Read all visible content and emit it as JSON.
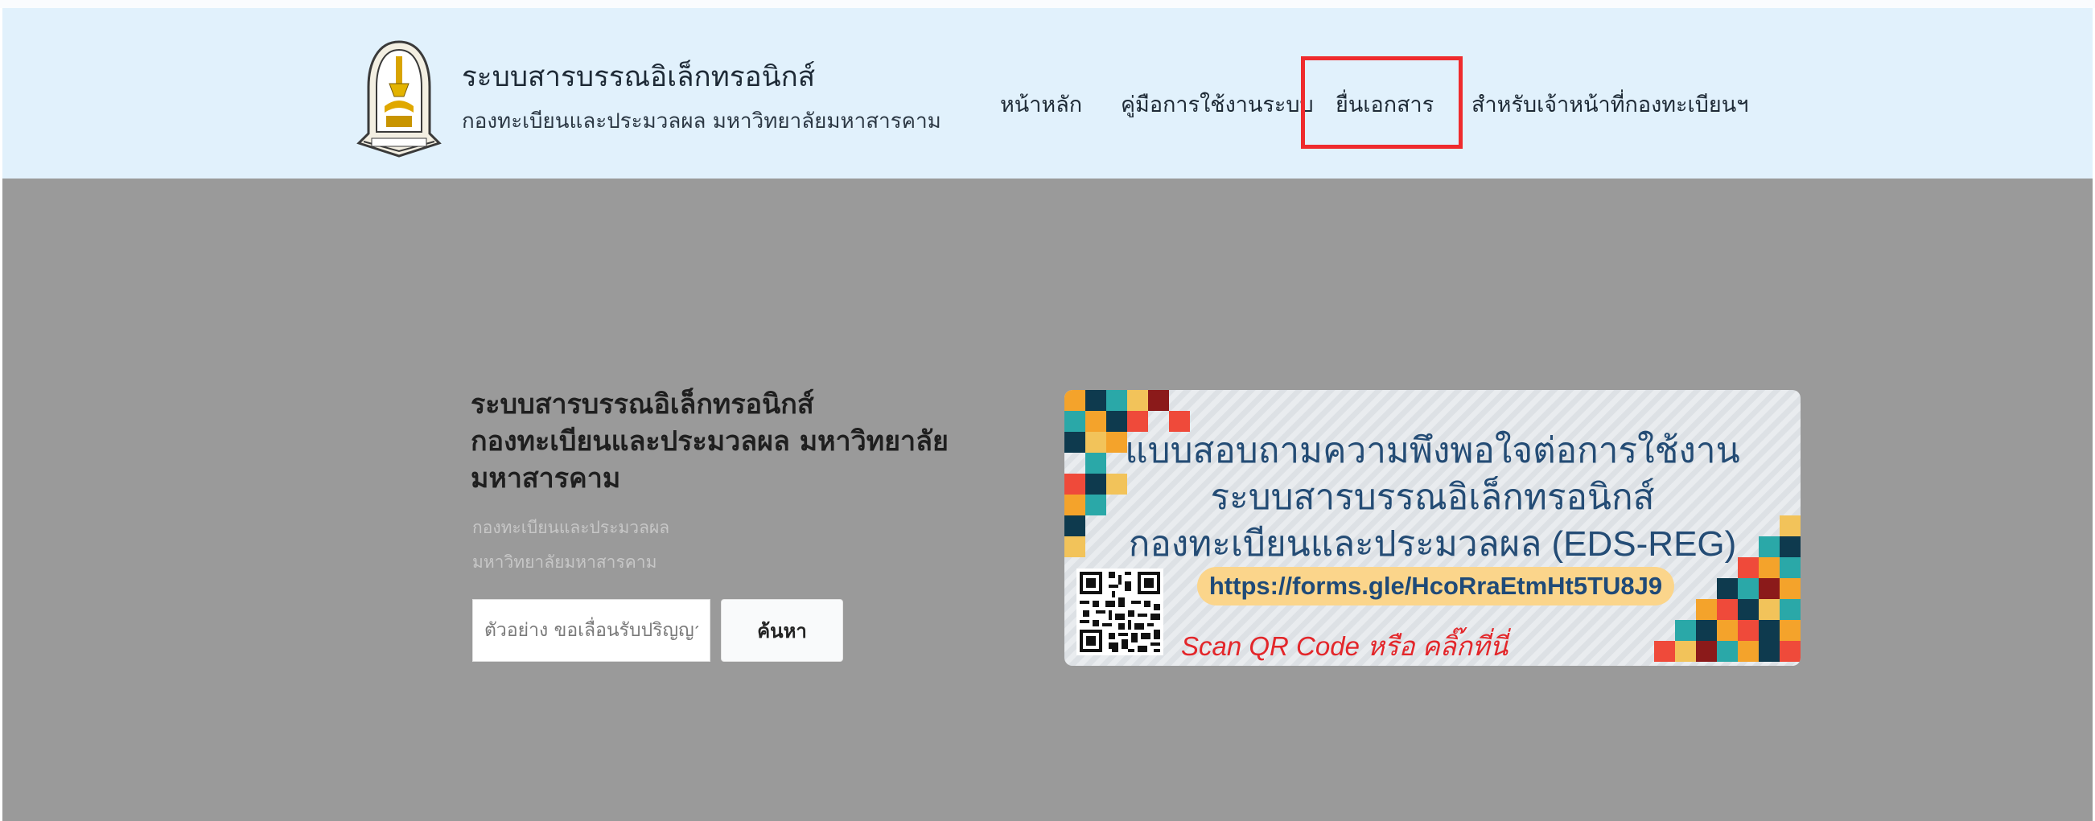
{
  "header": {
    "site_title": "ระบบสารบรรณอิเล็กทรอนิกส์",
    "site_subtitle": "กองทะเบียนและประมวลผล มหาวิทยาลัยมหาสารคาม",
    "nav": [
      {
        "label": "หน้าหลัก"
      },
      {
        "label": "คู่มือการใช้งานระบบ"
      },
      {
        "label": "ยื่นเอกสาร",
        "highlighted": true
      },
      {
        "label": "สำหรับเจ้าหน้าที่กองทะเบียนฯ"
      }
    ],
    "highlight_color": "#ef2b2d"
  },
  "hero": {
    "title_lines": [
      "ระบบสารบรรณอิเล็กทรอนิกส์",
      "กองทะเบียนและประมวลผล มหาวิทยาลัย",
      "มหาสารคาม"
    ],
    "sub_lines": [
      "กองทะเบียนและประมวลผล",
      "มหาวิทยาลัยมหาสารคาม"
    ],
    "search": {
      "placeholder": "ตัวอย่าง ขอเลื่อนรับปริญญา",
      "value": "",
      "button_label": "ค้นหา"
    }
  },
  "banner": {
    "lines": [
      "แบบสอบถามความพึงพอใจต่อการใช้งาน",
      "ระบบสารบรรณอิเล็กทรอนิกส์",
      "กองทะเบียนและประมวลผล (EDS-REG)"
    ],
    "url": "https://forms.gle/HcoRraEtmHt5TU8J9",
    "call_to_action": "Scan QR Code  หรือ  คลิ๊กที่นี่",
    "qr_icon": "qr-code-icon"
  },
  "colors": {
    "header_bg": "#e1f1fc",
    "hero_bg": "#9a9a9a",
    "banner_text": "#244c75",
    "banner_cta": "#e3262a"
  }
}
